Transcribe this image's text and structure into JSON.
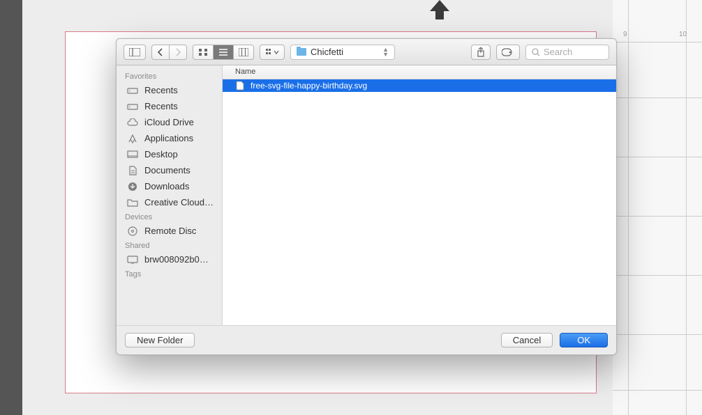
{
  "ruler": {
    "marks": [
      "9",
      "10"
    ]
  },
  "toolbar": {
    "path_label": "Chicfetti",
    "search_placeholder": "Search"
  },
  "sidebar": {
    "sections": [
      {
        "heading": "Favorites",
        "items": [
          {
            "icon": "drive",
            "label": "Recents"
          },
          {
            "icon": "drive",
            "label": "Recents"
          },
          {
            "icon": "cloud",
            "label": "iCloud Drive"
          },
          {
            "icon": "apps",
            "label": "Applications"
          },
          {
            "icon": "desktop",
            "label": "Desktop"
          },
          {
            "icon": "doc",
            "label": "Documents"
          },
          {
            "icon": "download",
            "label": "Downloads"
          },
          {
            "icon": "folder",
            "label": "Creative Cloud…"
          }
        ]
      },
      {
        "heading": "Devices",
        "items": [
          {
            "icon": "disc",
            "label": "Remote Disc"
          }
        ]
      },
      {
        "heading": "Shared",
        "items": [
          {
            "icon": "monitor",
            "label": "brw008092b0…"
          }
        ]
      },
      {
        "heading": "Tags",
        "items": []
      }
    ]
  },
  "list": {
    "column_header": "Name",
    "files": [
      {
        "name": "free-svg-file-happy-birthday.svg",
        "selected": true
      }
    ]
  },
  "footer": {
    "new_folder": "New Folder",
    "cancel": "Cancel",
    "ok": "OK"
  }
}
